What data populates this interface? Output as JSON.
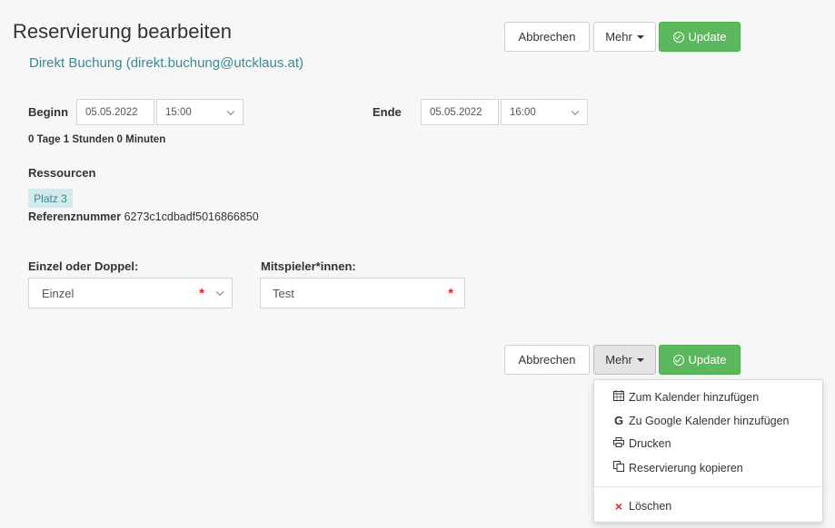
{
  "header": {
    "title": "Reservierung bearbeiten",
    "subtitle": "Direkt Buchung (direkt.buchung@utcklaus.at)"
  },
  "buttons": {
    "cancel": "Abbrechen",
    "more": "Mehr",
    "update": "Update"
  },
  "time": {
    "begin_label": "Beginn",
    "begin_date": "05.05.2022",
    "begin_time": "15:00",
    "end_label": "Ende",
    "end_date": "05.05.2022",
    "end_time": "16:00",
    "duration": "0 Tage 1 Stunden 0 Minuten"
  },
  "resources": {
    "label": "Ressourcen",
    "badge": "Platz 3",
    "ref_label": "Referenznummer",
    "ref_value": "6273c1cdbadf5016866850"
  },
  "form": {
    "type_label": "Einzel oder Doppel:",
    "type_value": "Einzel",
    "players_label": "Mitspieler*innen:",
    "players_value": "Test",
    "required_mark": "*"
  },
  "menu": {
    "items": [
      {
        "icon": "calendar-icon",
        "label": "Zum Kalender hinzufügen"
      },
      {
        "icon": "google-icon",
        "glyph": "G",
        "label": "Zu Google Kalender hinzufügen"
      },
      {
        "icon": "print-icon",
        "label": "Drucken"
      },
      {
        "icon": "copy-icon",
        "label": "Reservierung kopieren"
      },
      {
        "icon": "delete-icon",
        "glyph": "×",
        "label": "Löschen"
      }
    ]
  },
  "colors": {
    "accent_teal": "#3a8a93",
    "update_green": "#5cb85c",
    "required_red": "#e0242b",
    "badge_bg": "#d4e9ea"
  }
}
